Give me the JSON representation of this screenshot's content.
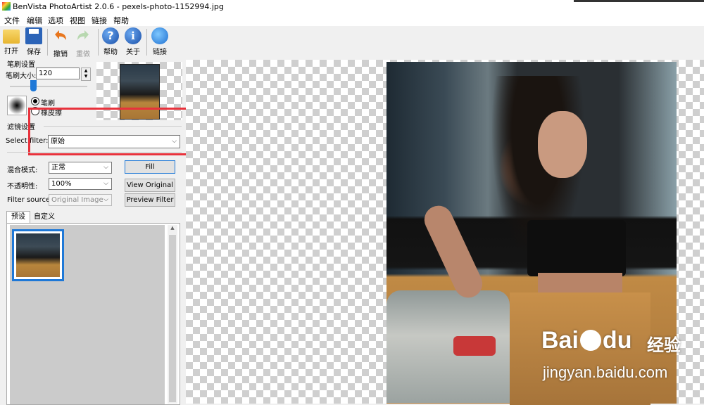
{
  "window": {
    "title": "BenVista PhotoArtist 2.0.6 - pexels-photo-1152994.jpg"
  },
  "menu": [
    "文件",
    "编辑",
    "选项",
    "视图",
    "链接",
    "帮助"
  ],
  "toolbar": {
    "open": "打开",
    "save": "保存",
    "undo": "撤销",
    "redo": "重做",
    "help": "帮助",
    "about": "关于",
    "link": "链接"
  },
  "brush": {
    "section": "笔刷设置",
    "size_label": "笔刷大小:",
    "size_value": "120",
    "slider_fraction": 0.3,
    "brush_option": "笔刷",
    "eraser_option": "橡皮擦"
  },
  "filter": {
    "section": "滤镜设置",
    "select_label": "Select filter:",
    "select_value": "原始"
  },
  "blend": {
    "mode_label": "混合模式:",
    "mode_value": "正常",
    "opacity_label": "不透明性:",
    "opacity_value": "100%",
    "source_label": "Filter source:",
    "source_value": "Original Image",
    "fill_button": "Fill",
    "view_original_button": "View Original",
    "preview_filter_button": "Preview Filter"
  },
  "tabs": [
    "预设",
    "自定义"
  ],
  "watermark": {
    "brand": "Bai",
    "brand2": "du",
    "cn": "经验",
    "url": "jingyan.baidu.com"
  },
  "colors": {
    "accent": "#1e78d7",
    "highlight": "#e8323c"
  }
}
